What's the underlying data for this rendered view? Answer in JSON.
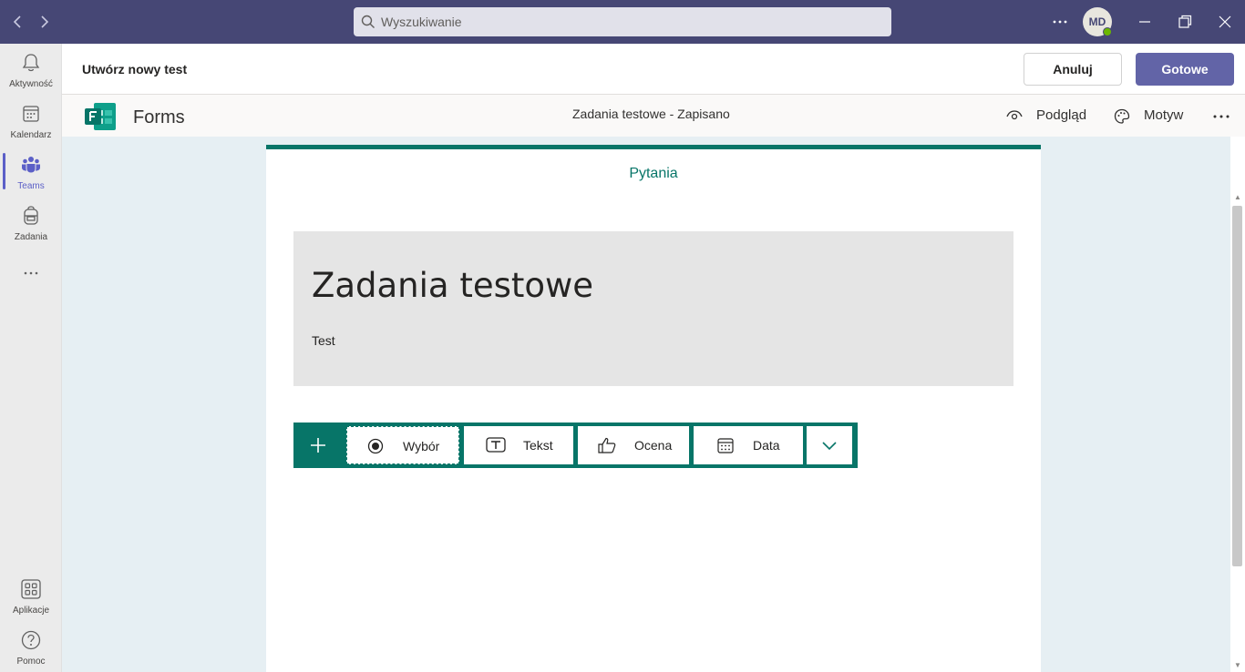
{
  "titlebar": {
    "back_icon": "chevron-left-icon",
    "forward_icon": "chevron-right-icon",
    "search_placeholder": "Wyszukiwanie",
    "more_icon": "more-horizontal-icon",
    "avatar_initials": "MD",
    "presence": "available",
    "minimize_icon": "minimize-icon",
    "maximize_icon": "restore-icon",
    "close_icon": "close-icon",
    "bg_color": "#464775"
  },
  "rail": {
    "items": [
      {
        "label": "Aktywność",
        "icon": "bell-icon"
      },
      {
        "label": "Kalendarz",
        "icon": "calendar-icon"
      },
      {
        "label": "Teams",
        "icon": "teams-icon",
        "active": true
      },
      {
        "label": "Zadania",
        "icon": "backpack-icon"
      },
      {
        "label": "…",
        "icon": "more-horizontal-icon"
      }
    ],
    "bottom_items": [
      {
        "label": "Aplikacje",
        "icon": "apps-icon"
      },
      {
        "label": "Pomoc",
        "icon": "help-icon"
      }
    ]
  },
  "header": {
    "title": "Utwórz nowy test",
    "cancel_label": "Anuluj",
    "done_label": "Gotowe",
    "accent": "#6264a7"
  },
  "forms_bar": {
    "app_name": "Forms",
    "status": "Zadania testowe - Zapisano",
    "preview_label": "Podgląd",
    "theme_label": "Motyw",
    "more_icon": "more-horizontal-icon"
  },
  "form": {
    "tab_label": "Pytania",
    "title": "Zadania testowe",
    "description": "Test",
    "accent": "#077568",
    "question_types": [
      {
        "label": "Wybór",
        "icon": "radio-icon",
        "selected": true
      },
      {
        "label": "Tekst",
        "icon": "text-icon"
      },
      {
        "label": "Ocena",
        "icon": "thumbs-up-icon"
      },
      {
        "label": "Data",
        "icon": "calendar-icon"
      }
    ]
  }
}
